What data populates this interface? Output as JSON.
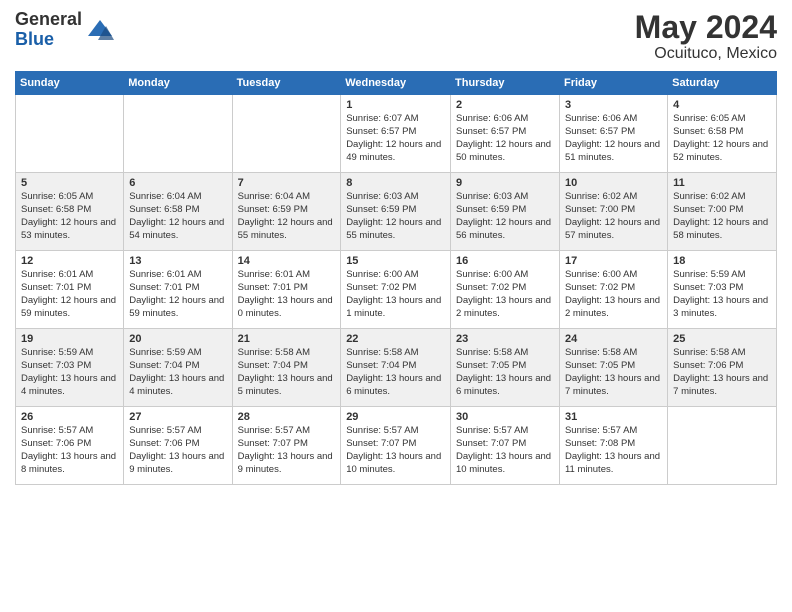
{
  "header": {
    "logo_general": "General",
    "logo_blue": "Blue",
    "title": "May 2024",
    "subtitle": "Ocuituco, Mexico"
  },
  "days_of_week": [
    "Sunday",
    "Monday",
    "Tuesday",
    "Wednesday",
    "Thursday",
    "Friday",
    "Saturday"
  ],
  "weeks": [
    [
      {
        "day": "",
        "info": ""
      },
      {
        "day": "",
        "info": ""
      },
      {
        "day": "",
        "info": ""
      },
      {
        "day": "1",
        "info": "Sunrise: 6:07 AM\nSunset: 6:57 PM\nDaylight: 12 hours\nand 49 minutes."
      },
      {
        "day": "2",
        "info": "Sunrise: 6:06 AM\nSunset: 6:57 PM\nDaylight: 12 hours\nand 50 minutes."
      },
      {
        "day": "3",
        "info": "Sunrise: 6:06 AM\nSunset: 6:57 PM\nDaylight: 12 hours\nand 51 minutes."
      },
      {
        "day": "4",
        "info": "Sunrise: 6:05 AM\nSunset: 6:58 PM\nDaylight: 12 hours\nand 52 minutes."
      }
    ],
    [
      {
        "day": "5",
        "info": "Sunrise: 6:05 AM\nSunset: 6:58 PM\nDaylight: 12 hours\nand 53 minutes."
      },
      {
        "day": "6",
        "info": "Sunrise: 6:04 AM\nSunset: 6:58 PM\nDaylight: 12 hours\nand 54 minutes."
      },
      {
        "day": "7",
        "info": "Sunrise: 6:04 AM\nSunset: 6:59 PM\nDaylight: 12 hours\nand 55 minutes."
      },
      {
        "day": "8",
        "info": "Sunrise: 6:03 AM\nSunset: 6:59 PM\nDaylight: 12 hours\nand 55 minutes."
      },
      {
        "day": "9",
        "info": "Sunrise: 6:03 AM\nSunset: 6:59 PM\nDaylight: 12 hours\nand 56 minutes."
      },
      {
        "day": "10",
        "info": "Sunrise: 6:02 AM\nSunset: 7:00 PM\nDaylight: 12 hours\nand 57 minutes."
      },
      {
        "day": "11",
        "info": "Sunrise: 6:02 AM\nSunset: 7:00 PM\nDaylight: 12 hours\nand 58 minutes."
      }
    ],
    [
      {
        "day": "12",
        "info": "Sunrise: 6:01 AM\nSunset: 7:01 PM\nDaylight: 12 hours\nand 59 minutes."
      },
      {
        "day": "13",
        "info": "Sunrise: 6:01 AM\nSunset: 7:01 PM\nDaylight: 12 hours\nand 59 minutes."
      },
      {
        "day": "14",
        "info": "Sunrise: 6:01 AM\nSunset: 7:01 PM\nDaylight: 13 hours\nand 0 minutes."
      },
      {
        "day": "15",
        "info": "Sunrise: 6:00 AM\nSunset: 7:02 PM\nDaylight: 13 hours\nand 1 minute."
      },
      {
        "day": "16",
        "info": "Sunrise: 6:00 AM\nSunset: 7:02 PM\nDaylight: 13 hours\nand 2 minutes."
      },
      {
        "day": "17",
        "info": "Sunrise: 6:00 AM\nSunset: 7:02 PM\nDaylight: 13 hours\nand 2 minutes."
      },
      {
        "day": "18",
        "info": "Sunrise: 5:59 AM\nSunset: 7:03 PM\nDaylight: 13 hours\nand 3 minutes."
      }
    ],
    [
      {
        "day": "19",
        "info": "Sunrise: 5:59 AM\nSunset: 7:03 PM\nDaylight: 13 hours\nand 4 minutes."
      },
      {
        "day": "20",
        "info": "Sunrise: 5:59 AM\nSunset: 7:04 PM\nDaylight: 13 hours\nand 4 minutes."
      },
      {
        "day": "21",
        "info": "Sunrise: 5:58 AM\nSunset: 7:04 PM\nDaylight: 13 hours\nand 5 minutes."
      },
      {
        "day": "22",
        "info": "Sunrise: 5:58 AM\nSunset: 7:04 PM\nDaylight: 13 hours\nand 6 minutes."
      },
      {
        "day": "23",
        "info": "Sunrise: 5:58 AM\nSunset: 7:05 PM\nDaylight: 13 hours\nand 6 minutes."
      },
      {
        "day": "24",
        "info": "Sunrise: 5:58 AM\nSunset: 7:05 PM\nDaylight: 13 hours\nand 7 minutes."
      },
      {
        "day": "25",
        "info": "Sunrise: 5:58 AM\nSunset: 7:06 PM\nDaylight: 13 hours\nand 7 minutes."
      }
    ],
    [
      {
        "day": "26",
        "info": "Sunrise: 5:57 AM\nSunset: 7:06 PM\nDaylight: 13 hours\nand 8 minutes."
      },
      {
        "day": "27",
        "info": "Sunrise: 5:57 AM\nSunset: 7:06 PM\nDaylight: 13 hours\nand 9 minutes."
      },
      {
        "day": "28",
        "info": "Sunrise: 5:57 AM\nSunset: 7:07 PM\nDaylight: 13 hours\nand 9 minutes."
      },
      {
        "day": "29",
        "info": "Sunrise: 5:57 AM\nSunset: 7:07 PM\nDaylight: 13 hours\nand 10 minutes."
      },
      {
        "day": "30",
        "info": "Sunrise: 5:57 AM\nSunset: 7:07 PM\nDaylight: 13 hours\nand 10 minutes."
      },
      {
        "day": "31",
        "info": "Sunrise: 5:57 AM\nSunset: 7:08 PM\nDaylight: 13 hours\nand 11 minutes."
      },
      {
        "day": "",
        "info": ""
      }
    ]
  ]
}
